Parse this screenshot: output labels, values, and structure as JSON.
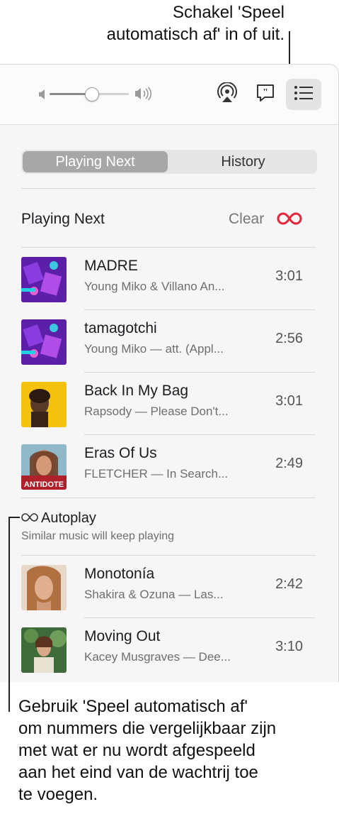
{
  "callouts": {
    "top": [
      "Schakel 'Speel",
      "automatisch af' in of uit."
    ],
    "bottom": [
      "Gebruik 'Speel automatisch af'",
      "om nummers die vergelijkbaar zijn",
      "met wat er nu wordt afgespeeld",
      "aan het eind van de wachtrij toe",
      "te voegen."
    ]
  },
  "toolbar": {
    "volume_level": 0.55,
    "icons": [
      "volume-low-icon",
      "volume-high-icon",
      "airplay-icon",
      "lyrics-icon",
      "queue-icon"
    ]
  },
  "tabs": {
    "playing_next": "Playing Next",
    "history": "History"
  },
  "section": {
    "title": "Playing Next",
    "clear_label": "Clear",
    "autoplay_icon": "infinity-icon"
  },
  "queue": [
    {
      "title": "MADRE",
      "subtitle": "Young Miko & Villano An...",
      "duration": "3:01"
    },
    {
      "title": "tamagotchi",
      "subtitle": "Young Miko — att. (Appl...",
      "duration": "2:56"
    },
    {
      "title": "Back In My Bag",
      "subtitle": "Rapsody — Please Don't...",
      "duration": "3:01"
    },
    {
      "title": "Eras Of Us",
      "subtitle": "FLETCHER — In Search...",
      "duration": "2:49",
      "art_text": "ANTIDOTE"
    }
  ],
  "autoplay": {
    "title": "Autoplay",
    "subtitle": "Similar music will keep playing",
    "tracks": [
      {
        "title": "Monotonía",
        "subtitle": "Shakira & Ozuna — Las...",
        "duration": "2:42"
      },
      {
        "title": "Moving Out",
        "subtitle": "Kacey Musgraves — Dee...",
        "duration": "3:10"
      }
    ]
  },
  "colors": {
    "accent": "#e5243b",
    "panel": "#f6f6f6"
  }
}
